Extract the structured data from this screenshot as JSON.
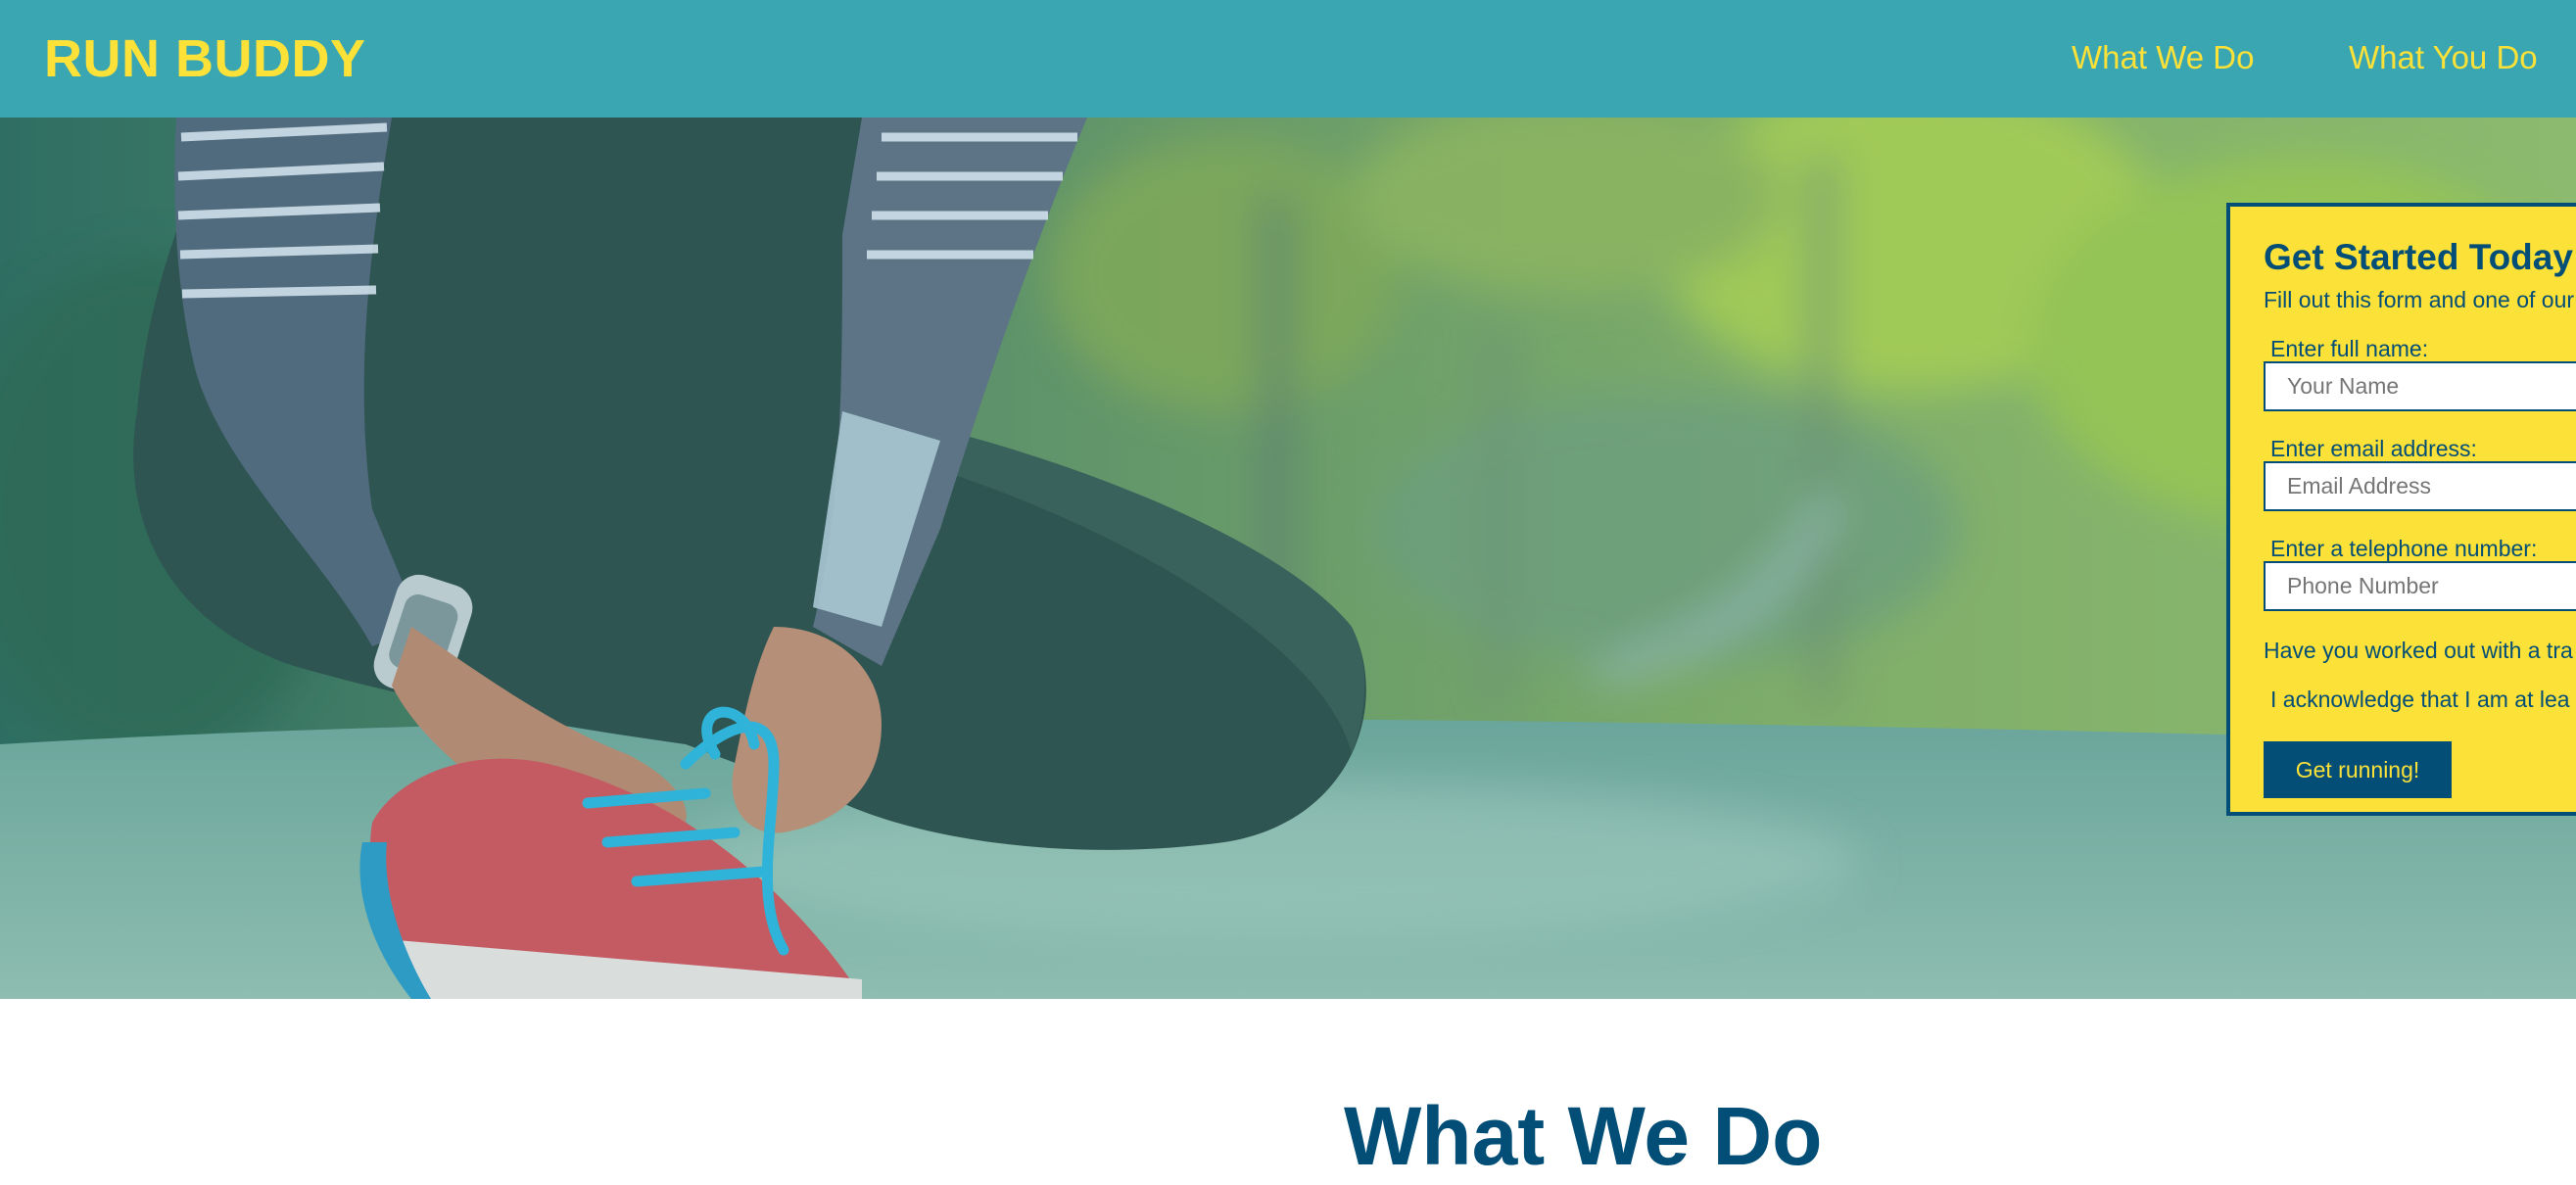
{
  "header": {
    "logo": "RUN BUDDY",
    "nav": [
      "What We Do",
      "What You Do"
    ]
  },
  "hero": {
    "image": "runner-tying-shoe-image"
  },
  "form": {
    "title": "Get Started Today",
    "intro": "Fill out this form and one of our",
    "name_label": "Enter full name:",
    "name_placeholder": "Your Name",
    "email_label": "Enter email address:",
    "email_placeholder": "Email Address",
    "phone_label": "Enter a telephone number:",
    "phone_placeholder": "Phone Number",
    "trainer_question": "Have you worked out with a tra",
    "acknowledge": "I acknowledge that I am at lea",
    "submit": "Get running!"
  },
  "section": {
    "title": "What We Do"
  },
  "colors": {
    "header_bg": "#39a6b2",
    "accent_yellow": "#fce138",
    "navy": "#024e76"
  }
}
